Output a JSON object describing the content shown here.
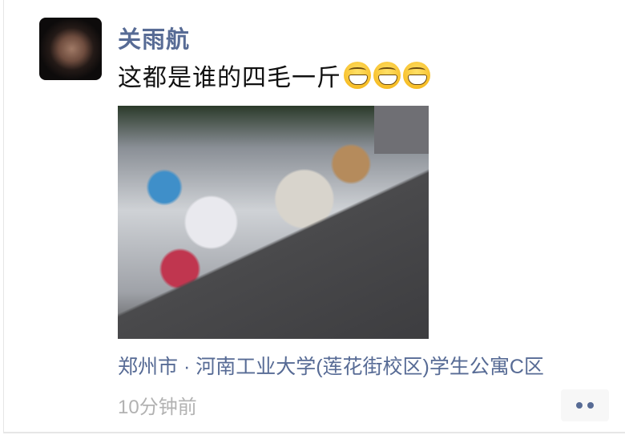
{
  "post": {
    "author_name": "关雨航",
    "text": "这都是谁的四毛一斤",
    "emojis": [
      "grinning-face-emoji",
      "grinning-face-emoji",
      "grinning-face-emoji"
    ],
    "location": "郑州市 · 河南工业大学(莲花街校区)学生公寓C区",
    "timestamp": "10分钟前",
    "link_color": "#576b95"
  }
}
